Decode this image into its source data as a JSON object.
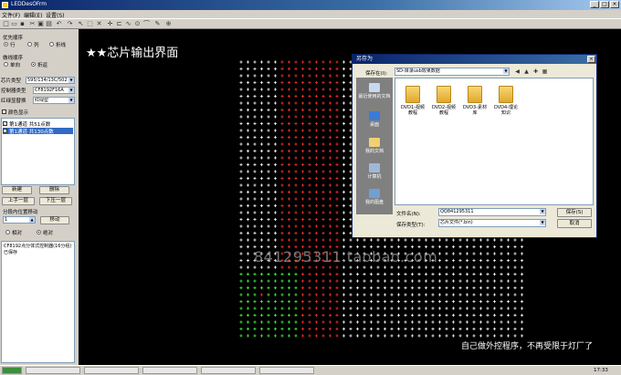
{
  "window": {
    "title": "LEDDesOFrm"
  },
  "menu": [
    "文件(F)",
    "编辑(E)",
    "设置(S)"
  ],
  "left_panel": {
    "priority_group": {
      "label": "优先顺序",
      "options": [
        "行",
        "列",
        "折线"
      ],
      "selected": 0
    },
    "scan_group": {
      "label": "做线顺序",
      "options": [
        "单向",
        "折返"
      ],
      "selected": 1
    },
    "chip_type": {
      "label": "芯片类型",
      "value": "595/134/13C/502"
    },
    "controller_type": {
      "label": "控制器类型",
      "value": "CF8192F16A"
    },
    "red_green_swap": {
      "label": "红绿显替换",
      "value": "红绿型"
    },
    "color_display": {
      "label": "颜色显示",
      "checked": false
    },
    "layers": [
      "第1通道 共51点数",
      "第1通道 共130点数"
    ],
    "buttons": {
      "new": "新建",
      "delete": "删除",
      "up": "上手一层",
      "down": "下压一层",
      "move": "移动"
    },
    "move_group": {
      "label": "分段内位置移动",
      "value": "1"
    },
    "mode_options": [
      "相对",
      "绝对"
    ],
    "mode_selected": 1,
    "info_text": "CF8192点分体式控制器(16分组)已保存"
  },
  "canvas": {
    "title": "★★芯片输出界面",
    "caption": "自己做外控程序，不再受限于灯厂了",
    "watermark": "841295311.taobao.com",
    "colors": {
      "white": "#ffffff",
      "red": "#ff3030",
      "green": "#40ff40"
    }
  },
  "dialog": {
    "title": "另存为",
    "save_in_label": "保存在(I):",
    "save_in_value": "SD-目录usb效果数据",
    "places": [
      "最近使用的文档",
      "桌面",
      "我的文档",
      "计算机",
      "我的图盘"
    ],
    "folders": [
      "DVD1-视频教程",
      "DVD2-视频教程",
      "DVD3-素材库",
      "DVD4-理论知识"
    ],
    "filename_label": "文件名(N):",
    "filename_value": "QQ841295311",
    "filetype_label": "保存类型(T):",
    "filetype_value": "芯片文件(*.bin)",
    "save_button": "保存(S)",
    "cancel_button": "取消"
  },
  "taskbar": {
    "clock": "17:33"
  }
}
